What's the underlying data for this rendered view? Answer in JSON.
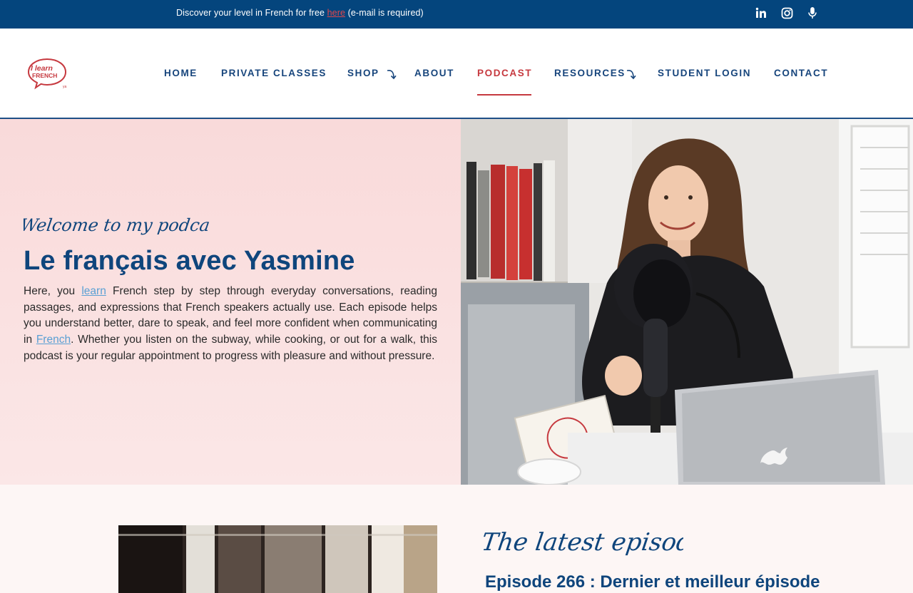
{
  "topbar": {
    "message_prefix": "Discover your level in French for free ",
    "message_link": "here",
    "message_suffix": " (e-mail is required)",
    "social_icons": [
      "linkedin-icon",
      "instagram-icon",
      "microphone-icon"
    ]
  },
  "logo": {
    "line1": "I learn",
    "line2": "FRENCH",
    "suffix": "ya"
  },
  "nav": {
    "items": [
      {
        "label": "HOME",
        "active": false
      },
      {
        "label": "PRIVATE CLASSES",
        "active": false
      },
      {
        "label": "SHOP",
        "active": false,
        "dropdown": true
      },
      {
        "label": "ABOUT",
        "active": false
      },
      {
        "label": "PODCAST",
        "active": true
      },
      {
        "label": "RESOURCES",
        "active": false,
        "dropdown": true
      },
      {
        "label": "STUDENT LOGIN",
        "active": false
      },
      {
        "label": "CONTACT",
        "active": false
      }
    ]
  },
  "hero": {
    "script_heading": "Welcome to my podcast",
    "title": "Le français avec Yasmine",
    "text_part1": "Here, you ",
    "text_link1": "learn",
    "text_part2": " French step by step through everyday conversations, reading passages, and expressions that French speakers actually use. Each episode helps you understand better, dare to speak, and feel more confident when communicating in ",
    "text_link2": "French",
    "text_part3": ". Whether you listen on the subway, while cooking, or out for a walk, this podcast is your regular appointment to progress with pleasure and without pressure."
  },
  "latest": {
    "script_heading": "The latest episodes",
    "episode_title": "Episode 266 : Dernier et meilleur épisode"
  },
  "colors": {
    "navy": "#04457d",
    "title_blue": "#0f457c",
    "accent_red": "#c6393f",
    "hero_pink": "#f9dada",
    "link_blue": "#5aa0d4"
  }
}
